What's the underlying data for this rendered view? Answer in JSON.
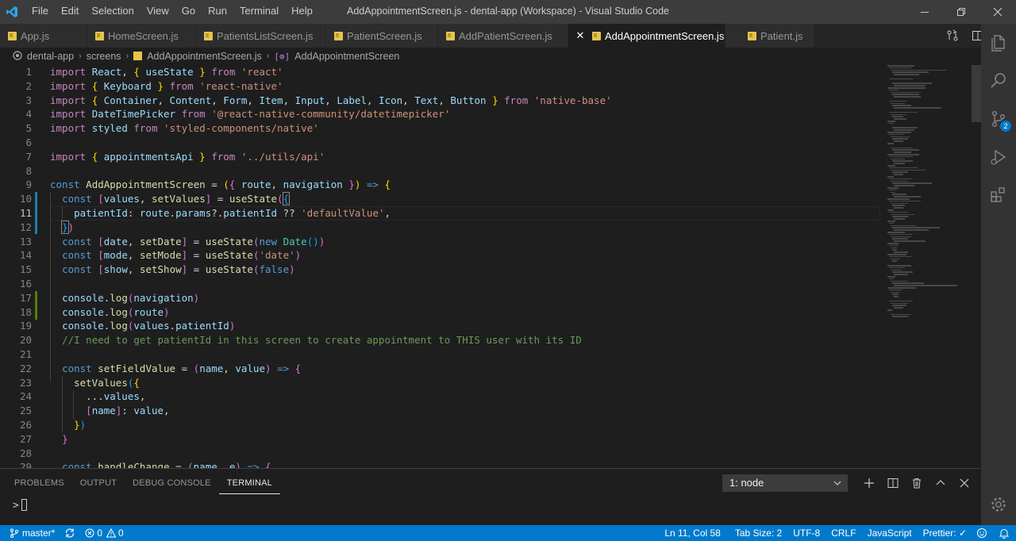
{
  "window": {
    "title": "AddAppointmentScreen.js - dental-app (Workspace) - Visual Studio Code",
    "menu": [
      "File",
      "Edit",
      "Selection",
      "View",
      "Go",
      "Run",
      "Terminal",
      "Help"
    ]
  },
  "tabs": [
    {
      "label": "App.js",
      "active": false
    },
    {
      "label": "HomeScreen.js",
      "active": false
    },
    {
      "label": "PatientsListScreen.js",
      "active": false
    },
    {
      "label": "PatientScreen.js",
      "active": false
    },
    {
      "label": "AddPatientScreen.js",
      "active": false
    },
    {
      "label": "AddAppointmentScreen.js",
      "active": true
    },
    {
      "label": "Patient.js",
      "active": false
    }
  ],
  "breadcrumb": {
    "root": "dental-app",
    "folder": "screens",
    "file": "AddAppointmentScreen.js",
    "symbol": "AddAppointmentScreen"
  },
  "editor": {
    "line_numbers": [
      "1",
      "2",
      "3",
      "4",
      "5",
      "6",
      "7",
      "8",
      "9",
      "10",
      "11",
      "12",
      "13",
      "14",
      "15",
      "16",
      "17",
      "18",
      "19",
      "20",
      "21",
      "22",
      "23",
      "24",
      "25",
      "26",
      "27",
      "28",
      "29"
    ],
    "current_line": 11
  },
  "panel": {
    "tabs": [
      "PROBLEMS",
      "OUTPUT",
      "DEBUG CONSOLE",
      "TERMINAL"
    ],
    "active_tab": "TERMINAL",
    "terminal_select": "1: node",
    "prompt": ">"
  },
  "statusbar": {
    "branch": "master*",
    "errors": "0",
    "warnings": "0",
    "position": "Ln 11, Col 58",
    "tab_size": "Tab Size: 2",
    "encoding": "UTF-8",
    "eol": "CRLF",
    "language": "JavaScript",
    "formatter": "Prettier: ✓"
  },
  "colors": {
    "accent": "#007acc",
    "title_bar": "#3c3c3c",
    "editor_bg": "#1e1e1e"
  }
}
